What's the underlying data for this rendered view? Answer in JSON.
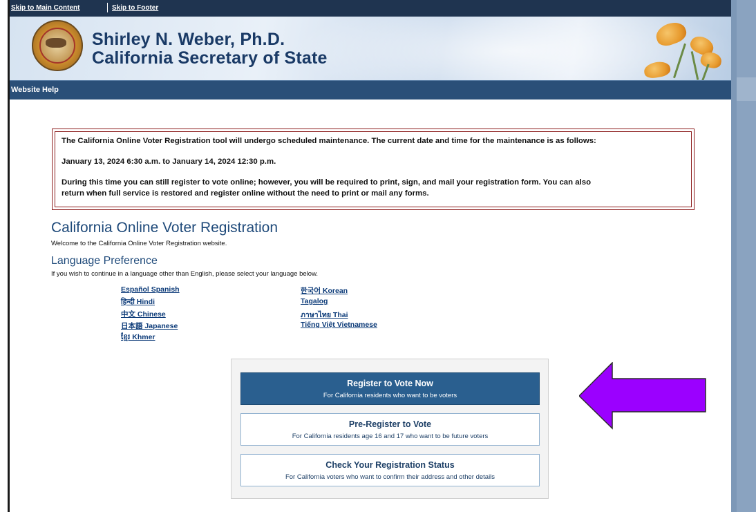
{
  "skip_links": {
    "main": "Skip to Main Content",
    "footer": "Skip to Footer"
  },
  "header": {
    "title_line1": "Shirley N. Weber, Ph.D.",
    "title_line2": "California Secretary of State"
  },
  "nav": {
    "website_help": "Website Help"
  },
  "notice": {
    "line1": "The California Online Voter Registration tool will undergo scheduled maintenance. The current date and time for the maintenance is as follows:",
    "line2": "January 13, 2024 6:30 a.m. to January 14, 2024 12:30 p.m.",
    "line3a": "During this time you can still register to vote online; however, you will be required to print, sign, and mail your registration form. You can also",
    "line3b": "return when full service is restored and register online without the need to print or mail any forms."
  },
  "main": {
    "heading": "California Online Voter Registration",
    "welcome": "Welcome to the California Online Voter Registration website.",
    "lang_heading": "Language Preference",
    "lang_instruction": "If you wish to continue in a language other than English, please select your language below."
  },
  "languages": {
    "col1": [
      "Español Spanish",
      "हिन्दी Hindi",
      "中文 Chinese",
      "日本語 Japanese",
      "ខ្មែរ Khmer"
    ],
    "col2": [
      "한국어 Korean",
      "Tagalog",
      "ภาษาไทย Thai",
      "Tiếng Việt Vietnamese"
    ]
  },
  "actions": {
    "register": {
      "title": "Register to Vote Now",
      "subtitle": "For California residents who want to be voters"
    },
    "preregister": {
      "title": "Pre-Register to Vote",
      "subtitle": "For California residents age 16 and 17 who want to be future voters"
    },
    "check_status": {
      "title": "Check Your Registration Status",
      "subtitle": "For California voters who want to confirm their address and other details"
    }
  },
  "colors": {
    "navy": "#1f3450",
    "nav_blue": "#2a4f78",
    "heading_blue": "#1f4a7a",
    "link_blue": "#0b3a78",
    "notice_border": "#8b1a1a",
    "primary_button": "#2a5f8f",
    "arrow": "#9b00ff"
  },
  "icons": {
    "seal": "california-seal-icon",
    "poppies": "poppy-flowers-icon",
    "annotation": "left-arrow-icon"
  }
}
